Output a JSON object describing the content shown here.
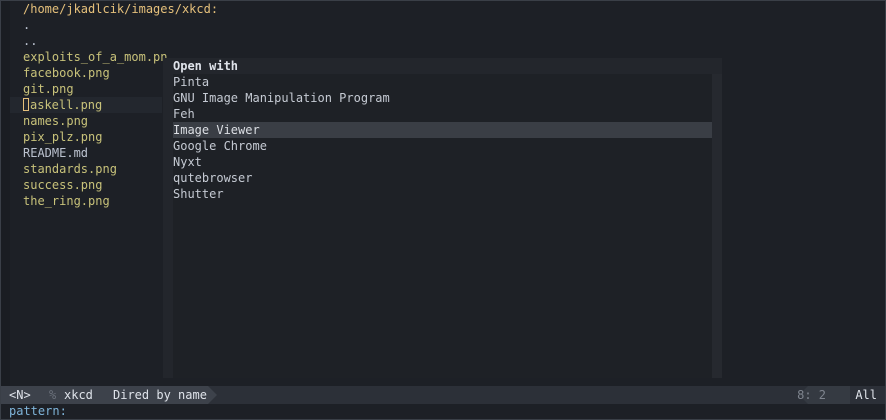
{
  "dired": {
    "header": "/home/jkadlcik/images/xkcd:",
    "entries": [
      {
        "name": ".",
        "kind": "dots"
      },
      {
        "name": "..",
        "kind": "dots"
      },
      {
        "name": "exploits_of_a_mom.pn",
        "kind": "img"
      },
      {
        "name": "facebook.png",
        "kind": "img"
      },
      {
        "name": "git.png",
        "kind": "img"
      },
      {
        "name": "haskell.png",
        "kind": "img",
        "cursor": true
      },
      {
        "name": "names.png",
        "kind": "img"
      },
      {
        "name": "pix_plz.png",
        "kind": "img"
      },
      {
        "name": "README.md",
        "kind": "plain"
      },
      {
        "name": "standards.png",
        "kind": "img"
      },
      {
        "name": "success.png",
        "kind": "img"
      },
      {
        "name": "the_ring.png",
        "kind": "img"
      }
    ]
  },
  "popup": {
    "title": "Open with",
    "items": [
      "Pinta",
      "GNU Image Manipulation Program",
      "Feh",
      "Image Viewer",
      "Google Chrome",
      "Nyxt",
      "qutebrowser",
      "Shutter"
    ],
    "selected_index": 3
  },
  "modeline": {
    "state": "<N>",
    "percent": "%",
    "buffer": "xkcd",
    "mode": "Dired by name",
    "position": "8: 2",
    "scroll": "All"
  },
  "minibuffer": {
    "prompt": "pattern:",
    "value": ""
  },
  "colors": {
    "background": "#1d2026",
    "header": "#e5c07b",
    "image_file": "#c8c27a",
    "selected_item": "#3a3e45",
    "prompt": "#7fb4d9"
  }
}
